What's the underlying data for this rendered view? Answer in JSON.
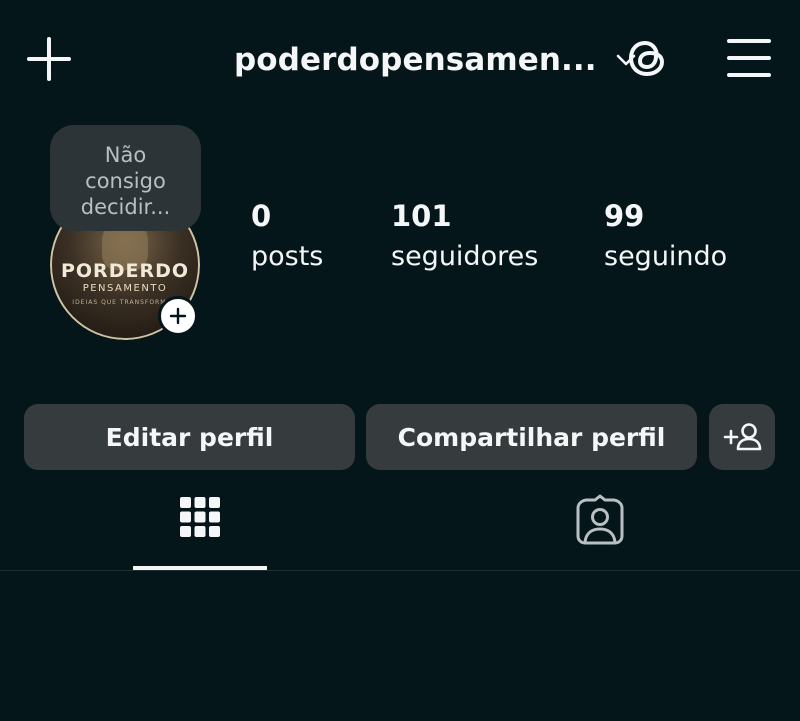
{
  "header": {
    "username": "poderdopensamen...",
    "add_icon": "plus-icon",
    "chevron_icon": "chevron-down-icon",
    "threads_icon": "threads-icon",
    "menu_icon": "hamburger-menu-icon"
  },
  "profile": {
    "note": "Não\nconsigo\ndecidir...",
    "avatar_title": "PORDERDO",
    "avatar_subtitle": "PENSAMENTO",
    "avatar_tagline": "IDEIAS QUE TRANSFORMAM",
    "add_story_icon": "plus-icon"
  },
  "stats": [
    {
      "value": "0",
      "label": "posts"
    },
    {
      "value": "101",
      "label": "seguidores"
    },
    {
      "value": "99",
      "label": "seguindo"
    }
  ],
  "actions": {
    "edit_profile": "Editar perfil",
    "share_profile": "Compartilhar perfil",
    "add_person_icon": "add-person-icon"
  },
  "tabs": [
    {
      "icon": "grid-icon",
      "active": true
    },
    {
      "icon": "tagged-person-icon",
      "active": false
    }
  ],
  "colors": {
    "background": "#05161a",
    "button": "#363b3e",
    "text": "#f4f6f7",
    "note_bubble": "#2d3437"
  }
}
